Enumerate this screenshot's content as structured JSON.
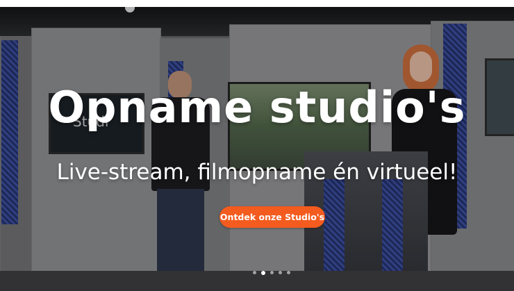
{
  "hero": {
    "title": "Opname studio's",
    "subtitle": "Live-stream, filmopname én virtueel!",
    "cta_label": "Ontdek onze Studio's",
    "background_screen_text": "Studi",
    "accent_color": "#f45b1f"
  },
  "carousel": {
    "slide_count": 5,
    "active_index": 1
  }
}
